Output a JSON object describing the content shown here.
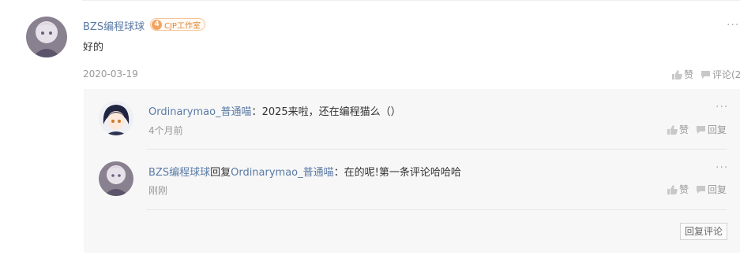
{
  "comment": {
    "author": "BZS编程球球",
    "badge": {
      "level": "4",
      "label": "CJP工作室"
    },
    "text": "好的",
    "date": "2020-03-19",
    "like_label": "赞",
    "comment_label": "评论(2"
  },
  "replies": [
    {
      "author": "Ordinarymao_普通喵",
      "separator": "：",
      "text": "2025来啦，还在编程猫么（）",
      "time": "4个月前",
      "like_label": "赞",
      "reply_label": "回复"
    },
    {
      "author": "BZS编程球球",
      "reply_word": "回复",
      "target": "Ordinarymao_普通喵",
      "separator": "：",
      "text": "在的呢!第一条评论哈哈哈",
      "time": "刚刚",
      "like_label": "赞",
      "reply_label": "回复"
    }
  ],
  "reply_comment_button": "回复评论",
  "more_glyph": "···",
  "colors": {
    "username": "#5a7ba6",
    "meta": "#999999",
    "reply_bg": "#f7f7f7",
    "badge_accent": "#f4a460"
  },
  "icons": [
    "thumbs-up-icon",
    "comment-icon",
    "more-icon"
  ]
}
